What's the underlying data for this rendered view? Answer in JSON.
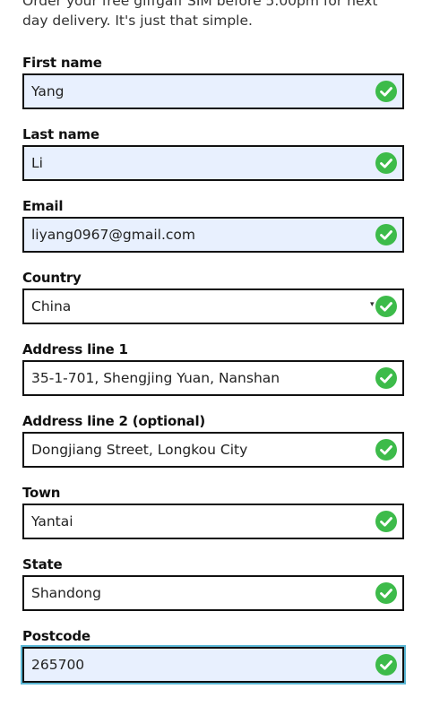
{
  "intro": {
    "line1": "Order your free giffgaff SIM before 5.00pm for next",
    "line2": "day delivery. It's just that simple."
  },
  "colors": {
    "autofill_background": "#e8f0fe",
    "valid_check": "#3dbb4a",
    "border": "#111111",
    "focus_ring": "#5bb7d5"
  },
  "form": {
    "first_name": {
      "label": "First name",
      "value": "Yang",
      "icon": "check-circle-icon"
    },
    "last_name": {
      "label": "Last name",
      "value": "Li",
      "icon": "check-circle-icon"
    },
    "email": {
      "label": "Email",
      "value": "liyang0967@gmail.com",
      "icon": "check-circle-icon"
    },
    "country": {
      "label": "Country",
      "value": "China",
      "icon": "check-circle-icon"
    },
    "address1": {
      "label": "Address line 1",
      "value": "35-1-701, Shengjing Yuan, Nanshan",
      "icon": "check-circle-icon"
    },
    "address2": {
      "label": "Address line 2 (optional)",
      "value": "Dongjiang Street, Longkou City",
      "icon": "check-circle-icon"
    },
    "town": {
      "label": "Town",
      "value": "Yantai",
      "icon": "check-circle-icon"
    },
    "state": {
      "label": "State",
      "value": "Shandong",
      "icon": "check-circle-icon"
    },
    "postcode": {
      "label": "Postcode",
      "value": "265700",
      "icon": "check-circle-icon"
    }
  }
}
